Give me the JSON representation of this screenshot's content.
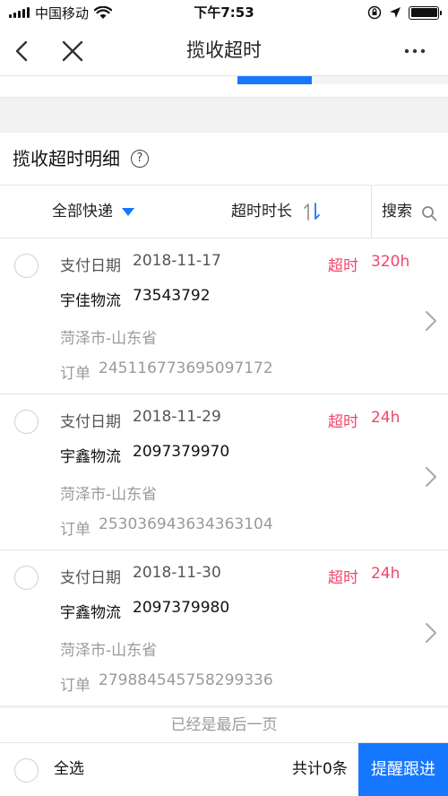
{
  "status_bar": {
    "carrier": "中国移动",
    "time": "下午7:53"
  },
  "nav": {
    "title": "揽收超时"
  },
  "section": {
    "title": "揽收超时明细",
    "help_glyph": "?"
  },
  "filters": {
    "all_couriers": "全部快递",
    "timeout_duration": "超时时长",
    "search": "搜索"
  },
  "orders": [
    {
      "pay_label": "支付日期",
      "pay_date": "2018-11-17",
      "overtime_label": "超时",
      "hours": "320h",
      "carrier": "宇佳物流",
      "tracking": "73543792",
      "region": "菏泽市-山东省",
      "order_label": "订单",
      "order_no": "245116773695097172"
    },
    {
      "pay_label": "支付日期",
      "pay_date": "2018-11-29",
      "overtime_label": "超时",
      "hours": "24h",
      "carrier": "宇鑫物流",
      "tracking": "2097379970",
      "region": "菏泽市-山东省",
      "order_label": "订单",
      "order_no": "253036943634363104"
    },
    {
      "pay_label": "支付日期",
      "pay_date": "2018-11-30",
      "overtime_label": "超时",
      "hours": "24h",
      "carrier": "宇鑫物流",
      "tracking": "2097379980",
      "region": "菏泽市-山东省",
      "order_label": "订单",
      "order_no": "279884545758299336"
    }
  ],
  "footer": {
    "last_page": "已经是最后一页",
    "select_all": "全选",
    "total": "共计0条",
    "remind_button": "提醒跟进"
  },
  "colors": {
    "accent": "#1677ff",
    "overtime": "#f0466a"
  },
  "icons": {
    "back": "chevron-left-icon",
    "close": "close-icon",
    "more": "more-icon",
    "help": "help-icon",
    "sort": "sort-icon",
    "search": "search-icon",
    "row_chevron": "chevron-right-icon"
  }
}
